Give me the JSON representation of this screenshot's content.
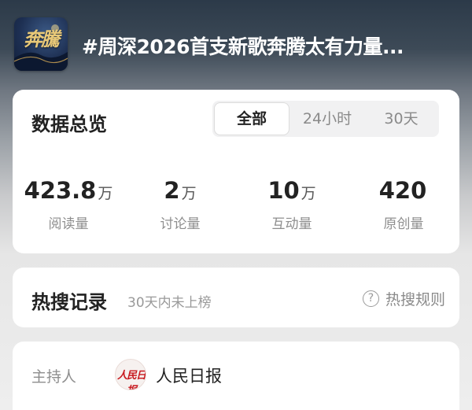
{
  "header": {
    "cover_text": "奔騰",
    "title": "#周深2026首支新歌奔腾太有力量..."
  },
  "overview": {
    "title": "数据总览",
    "tabs": [
      {
        "label": "全部",
        "active": true
      },
      {
        "label": "24小时",
        "active": false
      },
      {
        "label": "30天",
        "active": false
      }
    ],
    "stats": [
      {
        "value": "423.8",
        "unit": "万",
        "label": "阅读量"
      },
      {
        "value": "2",
        "unit": "万",
        "label": "讨论量"
      },
      {
        "value": "10",
        "unit": "万",
        "label": "互动量"
      },
      {
        "value": "420",
        "unit": "",
        "label": "原创量"
      }
    ]
  },
  "hot_search": {
    "title": "热搜记录",
    "subtitle": "30天内未上榜",
    "rules_icon": "question-circle-icon",
    "rules_label": "热搜规则"
  },
  "host": {
    "label": "主持人",
    "avatar_text": "人民日报",
    "name": "人民日报"
  },
  "colors": {
    "text_primary": "#222222",
    "text_secondary": "#8e8e8e",
    "card_bg": "#ffffff",
    "avatar_brand": "#c8191f"
  }
}
